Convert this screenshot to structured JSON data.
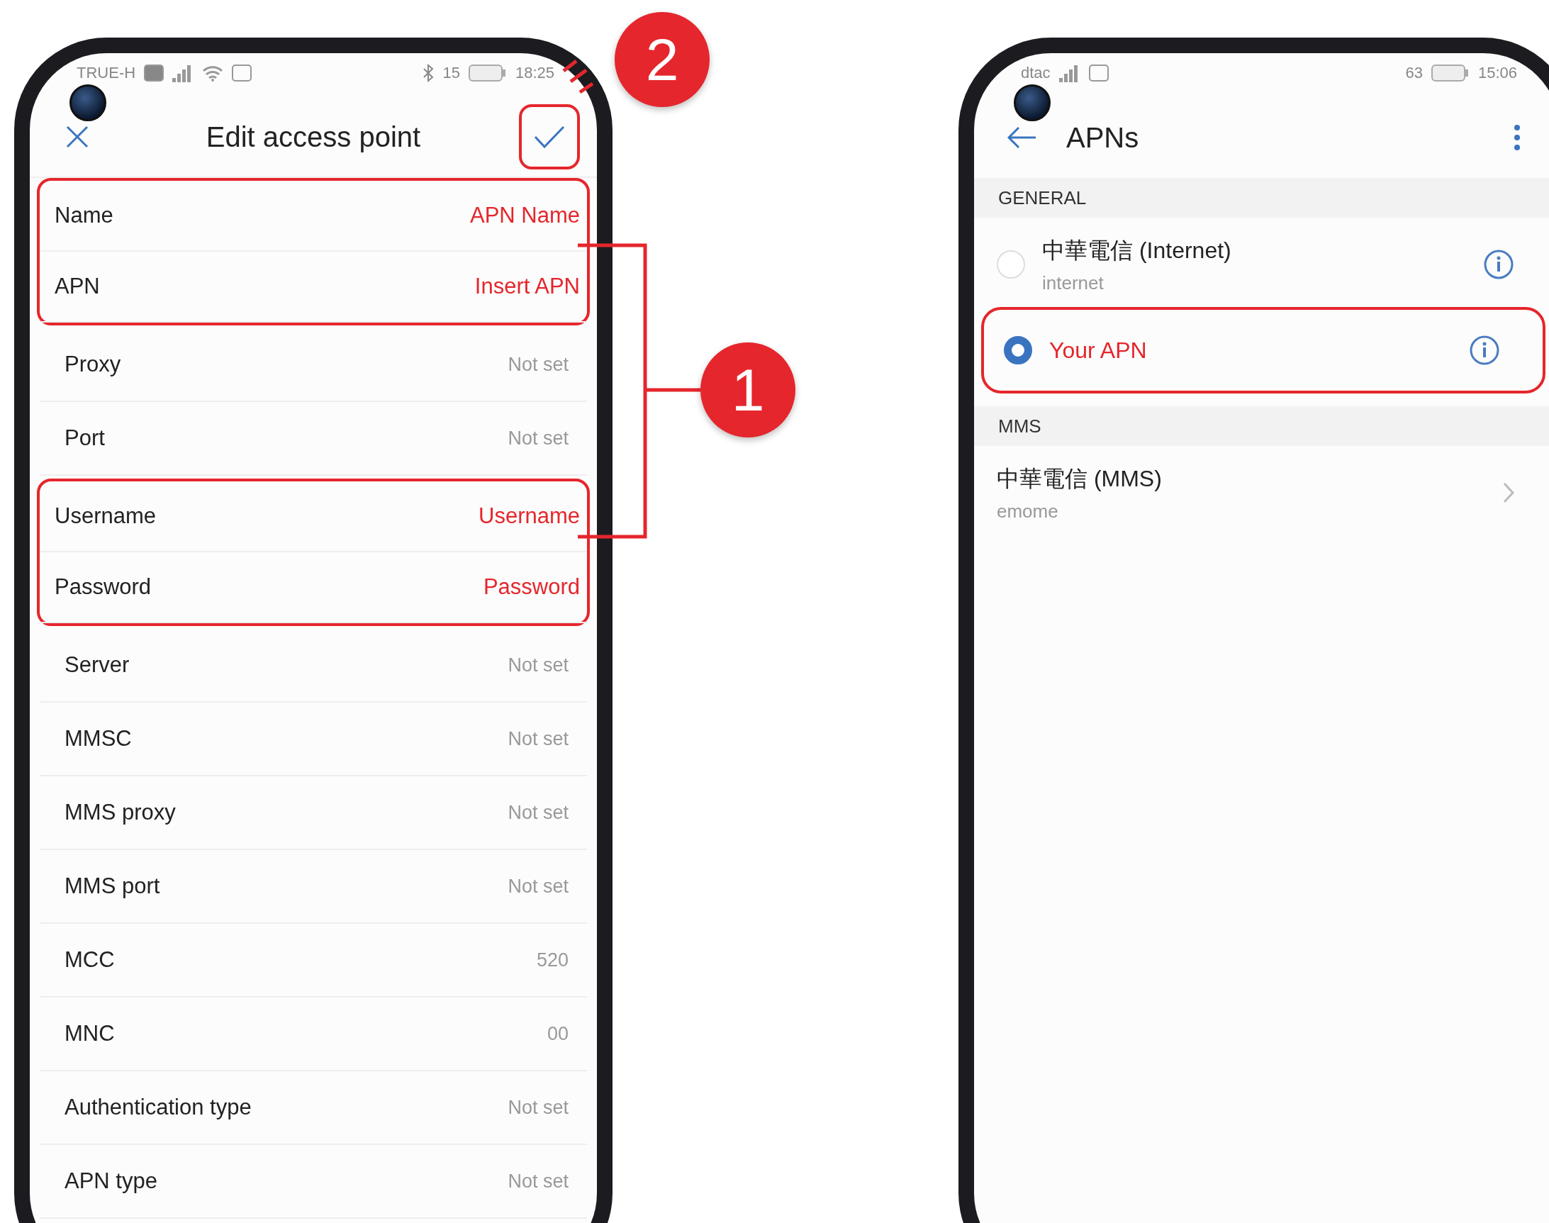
{
  "left_phone": {
    "status_bar": {
      "carrier": "TRUE-H",
      "battery": "15",
      "time": "18:25"
    },
    "header": {
      "title": "Edit access point",
      "confirm_highlighted": true
    },
    "fields": [
      {
        "label": "Name",
        "value": "APN Name",
        "highlighted": true
      },
      {
        "label": "APN",
        "value": "Insert APN",
        "highlighted": true
      },
      {
        "label": "Proxy",
        "value": "Not set",
        "highlighted": false
      },
      {
        "label": "Port",
        "value": "Not set",
        "highlighted": false
      },
      {
        "label": "Username",
        "value": "Username",
        "highlighted": true
      },
      {
        "label": "Password",
        "value": "Password",
        "highlighted": true
      },
      {
        "label": "Server",
        "value": "Not set",
        "highlighted": false
      },
      {
        "label": "MMSC",
        "value": "Not set",
        "highlighted": false
      },
      {
        "label": "MMS proxy",
        "value": "Not set",
        "highlighted": false
      },
      {
        "label": "MMS port",
        "value": "Not set",
        "highlighted": false
      },
      {
        "label": "MCC",
        "value": "520",
        "highlighted": false
      },
      {
        "label": "MNC",
        "value": "00",
        "highlighted": false
      },
      {
        "label": "Authentication type",
        "value": "Not set",
        "highlighted": false
      },
      {
        "label": "APN type",
        "value": "Not set",
        "highlighted": false
      }
    ]
  },
  "right_phone": {
    "status_bar": {
      "carrier": "dtac",
      "battery": "63",
      "time": "15:06"
    },
    "header": {
      "title": "APNs"
    },
    "sections": [
      {
        "title": "GENERAL",
        "items": [
          {
            "kind": "radio",
            "title": "中華電信 (Internet)",
            "subtitle": "internet",
            "selected": false,
            "highlighted": false
          },
          {
            "kind": "radio",
            "title": "Your APN",
            "selected": true,
            "highlighted": true
          }
        ]
      },
      {
        "title": "MMS",
        "items": [
          {
            "kind": "link",
            "title": "中華電信 (MMS)",
            "subtitle": "emome",
            "highlighted": false
          }
        ]
      }
    ]
  },
  "annotations": [
    {
      "label": "1"
    },
    {
      "label": "2"
    }
  ]
}
